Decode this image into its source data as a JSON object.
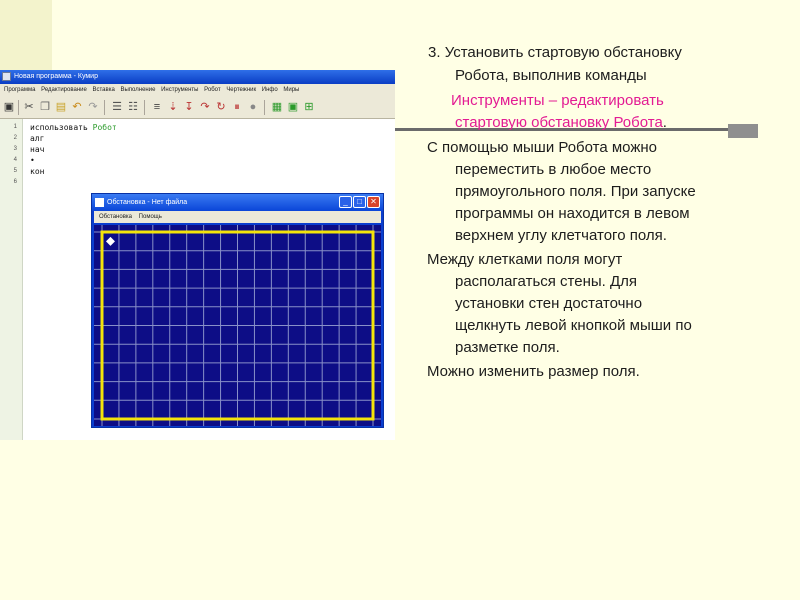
{
  "colors": {
    "slide_background": "#ffffe5",
    "highlight_text": "#e31b93",
    "field_background": "#0d0d86",
    "field_border": "#f4e40a",
    "grid_lines": "#8890c8",
    "code_keyword_green": "#2a9a2a"
  },
  "kumir_window": {
    "title": "Новая программа - Кумир",
    "menu": [
      "Программа",
      "Редактирование",
      "Вставка",
      "Выполнение",
      "Инструменты",
      "Робот",
      "Чертежник",
      "Инфо",
      "Миры"
    ],
    "line_numbers": [
      "1",
      "2",
      "3",
      "4",
      "5",
      "6"
    ],
    "code": {
      "line1_keyword": "использовать",
      "line1_name": "Робот",
      "line2": "алг",
      "line3": "нач",
      "line4": "•",
      "line5": "кон"
    }
  },
  "obstanovka_window": {
    "title": "Обстановка - Нет файла",
    "menu": [
      "Обстановка",
      "Помощь"
    ],
    "field": {
      "columns": 16,
      "rows": 10,
      "robot_position": [
        1,
        1
      ]
    }
  },
  "slide_text": {
    "step_number": "3.",
    "step_line1": "Установить стартовую обстановку",
    "step_line2": "Робота, выполнив команды",
    "instr_line1": "Инструменты – редактировать",
    "instr_line2": "стартовую обстановку Робота",
    "instr_period": ".",
    "para1_lines": [
      "С помощью мыши Робота можно",
      "переместить в любое место",
      "прямоугольного поля.  При запуске",
      "программы он находится в левом",
      "верхнем углу клетчатого поля."
    ],
    "para2_lines": [
      "Между клетками поля могут",
      "располагаться стены. Для",
      "установки стен достаточно",
      "щелкнуть левой кнопкой мыши по",
      "разметке поля."
    ],
    "para3": "Можно изменить размер поля."
  }
}
